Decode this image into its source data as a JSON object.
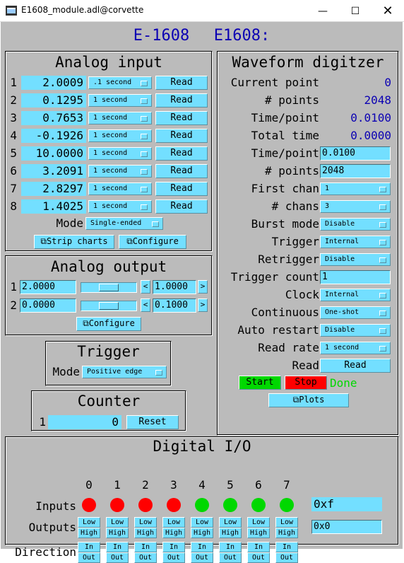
{
  "window": {
    "title": "E1608_module.adl@corvette"
  },
  "header": {
    "prefix": "E-1608",
    "name": "E1608:"
  },
  "analog_input": {
    "title": "Analog input",
    "channels": [
      {
        "n": "1",
        "value": "2.0009",
        "rate": ".1 second",
        "read": "Read"
      },
      {
        "n": "2",
        "value": "0.1295",
        "rate": "1 second",
        "read": "Read"
      },
      {
        "n": "3",
        "value": "0.7653",
        "rate": "1 second",
        "read": "Read"
      },
      {
        "n": "4",
        "value": "-0.1926",
        "rate": "1 second",
        "read": "Read"
      },
      {
        "n": "5",
        "value": "10.0000",
        "rate": "1 second",
        "read": "Read"
      },
      {
        "n": "6",
        "value": "3.2091",
        "rate": "1 second",
        "read": "Read"
      },
      {
        "n": "7",
        "value": "2.8297",
        "rate": "1 second",
        "read": "Read"
      },
      {
        "n": "8",
        "value": "1.4025",
        "rate": "1 second",
        "read": "Read"
      }
    ],
    "mode_label": "Mode",
    "mode_value": "Single-ended",
    "strip_charts": "Strip charts",
    "configure": "Configure"
  },
  "analog_output": {
    "title": "Analog output",
    "channels": [
      {
        "n": "1",
        "value": "2.0000",
        "step": "1.0000",
        "slider_fraction": 0.5
      },
      {
        "n": "2",
        "value": "0.0000",
        "step": "0.1000",
        "slider_fraction": 0.5
      }
    ],
    "configure": "Configure"
  },
  "trigger": {
    "title": "Trigger",
    "mode_label": "Mode",
    "mode_value": "Positive edge"
  },
  "counter": {
    "title": "Counter",
    "n": "1",
    "value": "0",
    "reset": "Reset"
  },
  "waveform": {
    "title": "Waveform digitzer",
    "readbacks": [
      {
        "label": "Current point",
        "value": "0"
      },
      {
        "label": "# points",
        "value": "2048"
      },
      {
        "label": "Time/point",
        "value": "0.0100"
      },
      {
        "label": "Total time",
        "value": "0.0000"
      }
    ],
    "time_point_label": "Time/point",
    "time_point_value": "0.0100",
    "points_label": "# points",
    "points_value": "2048",
    "menus": [
      {
        "label": "First chan",
        "value": "1"
      },
      {
        "label": "# chans",
        "value": "3"
      },
      {
        "label": "Burst mode",
        "value": "Disable"
      },
      {
        "label": "Trigger",
        "value": "Internal"
      },
      {
        "label": "Retrigger",
        "value": "Disable"
      }
    ],
    "trigger_count_label": "Trigger count",
    "trigger_count_value": "1",
    "menus2": [
      {
        "label": "Clock",
        "value": "Internal"
      },
      {
        "label": "Continuous",
        "value": "One-shot"
      },
      {
        "label": "Auto restart",
        "value": "Disable"
      },
      {
        "label": "Read rate",
        "value": "1 second"
      }
    ],
    "read_label": "Read",
    "read_button": "Read",
    "start": "Start",
    "stop": "Stop",
    "status": "Done",
    "plots": "Plots",
    "colors": {
      "start": "#00d800",
      "stop": "#ff0000",
      "status": "#00d800"
    }
  },
  "digital_io": {
    "title": "Digital I/O",
    "bits": [
      "0",
      "1",
      "2",
      "3",
      "4",
      "5",
      "6",
      "7"
    ],
    "inputs_label": "Inputs",
    "input_states": [
      "red",
      "red",
      "red",
      "red",
      "green",
      "green",
      "green",
      "green"
    ],
    "inputs_value": "0xf",
    "outputs_label": "Outputs",
    "low": "Low",
    "high": "High",
    "outputs_value": "0x0",
    "direction_label": "Direction",
    "in": "In",
    "out": "Out",
    "colors": {
      "red": "#ff0000",
      "green": "#00d800"
    }
  }
}
